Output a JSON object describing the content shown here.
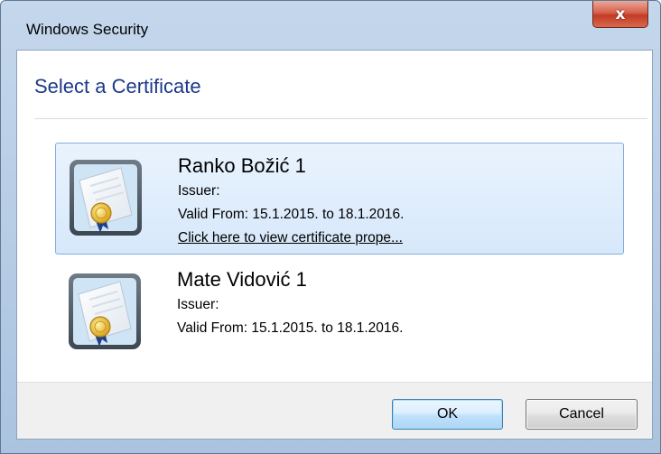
{
  "window": {
    "title": "Windows Security",
    "close_label": "x"
  },
  "heading": "Select a Certificate",
  "certificates": [
    {
      "name": "Ranko Božić 1",
      "issuer": "Issuer:",
      "valid": "Valid From: 15.1.2015. to 18.1.2016.",
      "link": "Click here to view certificate prope...",
      "selected": true
    },
    {
      "name": "Mate Vidović 1",
      "issuer": "Issuer:",
      "valid": "Valid From: 15.1.2015. to 18.1.2016.",
      "selected": false
    }
  ],
  "buttons": {
    "ok": "OK",
    "cancel": "Cancel"
  },
  "colors": {
    "heading": "#1c3a8a",
    "selection": "#d7e8fb",
    "close": "#c23b25"
  }
}
